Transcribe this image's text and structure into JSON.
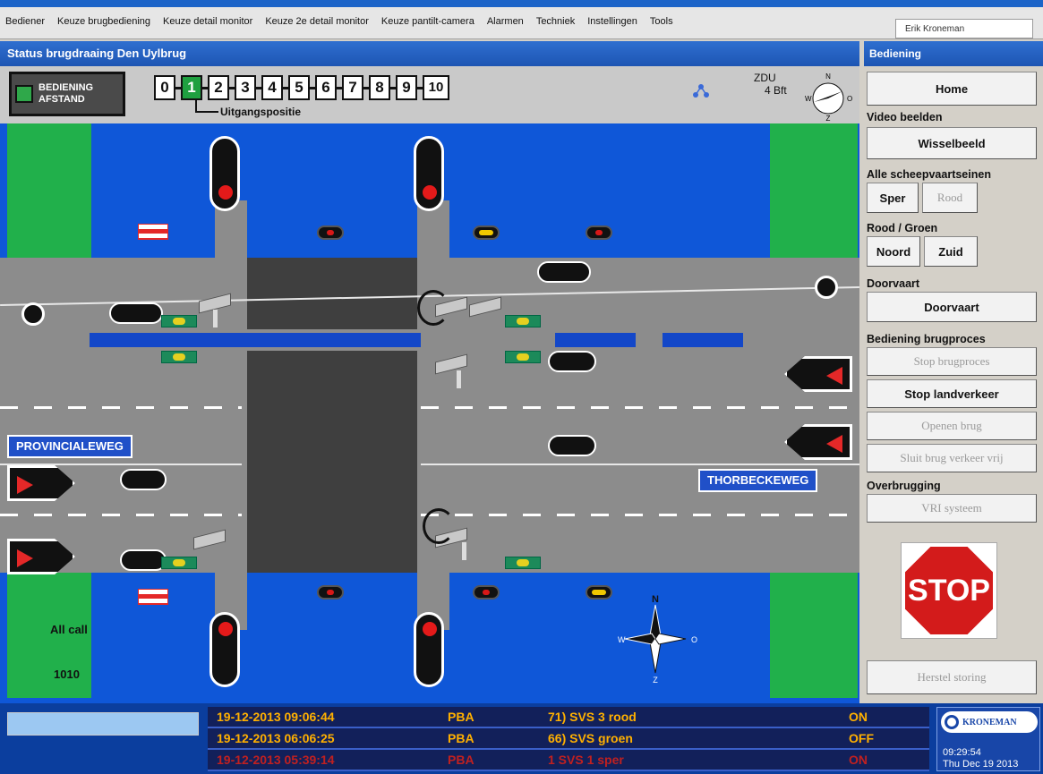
{
  "menu": {
    "items": [
      "Bediener",
      "Keuze brugbediening",
      "Keuze detail monitor",
      "Keuze 2e detail monitor",
      "Keuze pantilt-camera",
      "Alarmen",
      "Techniek",
      "Instellingen",
      "Tools"
    ],
    "user": "Erik Kroneman"
  },
  "title": "Status brugdraaing Den Uylbrug",
  "panel_title": "Bediening",
  "mode": {
    "line1": "BEDIENING",
    "line2": "AFSTAND"
  },
  "steps": {
    "values": [
      "0",
      "1",
      "2",
      "3",
      "4",
      "5",
      "6",
      "7",
      "8",
      "9",
      "10"
    ],
    "active_index": 1,
    "caption": "Uitgangspositie"
  },
  "wind": {
    "label": "ZDU",
    "value": "4 Bft"
  },
  "compass": {
    "n": "N",
    "z": "Z",
    "w": "W",
    "o": "O"
  },
  "roads": {
    "left": "PROVINCIALEWEG",
    "right": "THORBECKEWEG"
  },
  "side_labels": {
    "allcall": "All call",
    "code": "1010"
  },
  "panel": {
    "home": "Home",
    "video_label": "Video beelden",
    "wisselbeeld": "Wisselbeeld",
    "alle_label": "Alle scheepvaartseinen",
    "sper": "Sper",
    "rood": "Rood",
    "roodgroen_label": "Rood / Groen",
    "noord": "Noord",
    "zuid": "Zuid",
    "doorvaart_label": "Doorvaart",
    "doorvaart": "Doorvaart",
    "bediening_label": "Bediening brugproces",
    "stop_brugproces": "Stop brugproces",
    "stop_landverkeer": "Stop landverkeer",
    "openen_brug": "Openen brug",
    "sluit_brug": "Sluit brug verkeer vrij",
    "overbrugging_label": "Overbrugging",
    "vri": "VRI systeem",
    "stop_text": "STOP",
    "herstel": "Herstel storing"
  },
  "alarms": [
    {
      "date": "19-12-2013  09:06:44",
      "src": "PBA",
      "msg": "71) SVS 3 rood",
      "state": "ON"
    },
    {
      "date": "19-12-2013  06:06:25",
      "src": "PBA",
      "msg": "66) SVS groen",
      "state": "OFF"
    },
    {
      "date": "19-12-2013  05:39:14",
      "src": "PBA",
      "msg": "1 SVS 1 sper",
      "state": "ON"
    }
  ],
  "brand": {
    "name": "KRONEMAN",
    "time": "09:29:54",
    "date": "Thu Dec 19 2013"
  },
  "colors": {
    "water": "#0f57d8",
    "grass": "#21b04b",
    "road": "#8c8c8c",
    "accent_blue": "#1d55b3",
    "alarm_text": "#ffb000"
  }
}
